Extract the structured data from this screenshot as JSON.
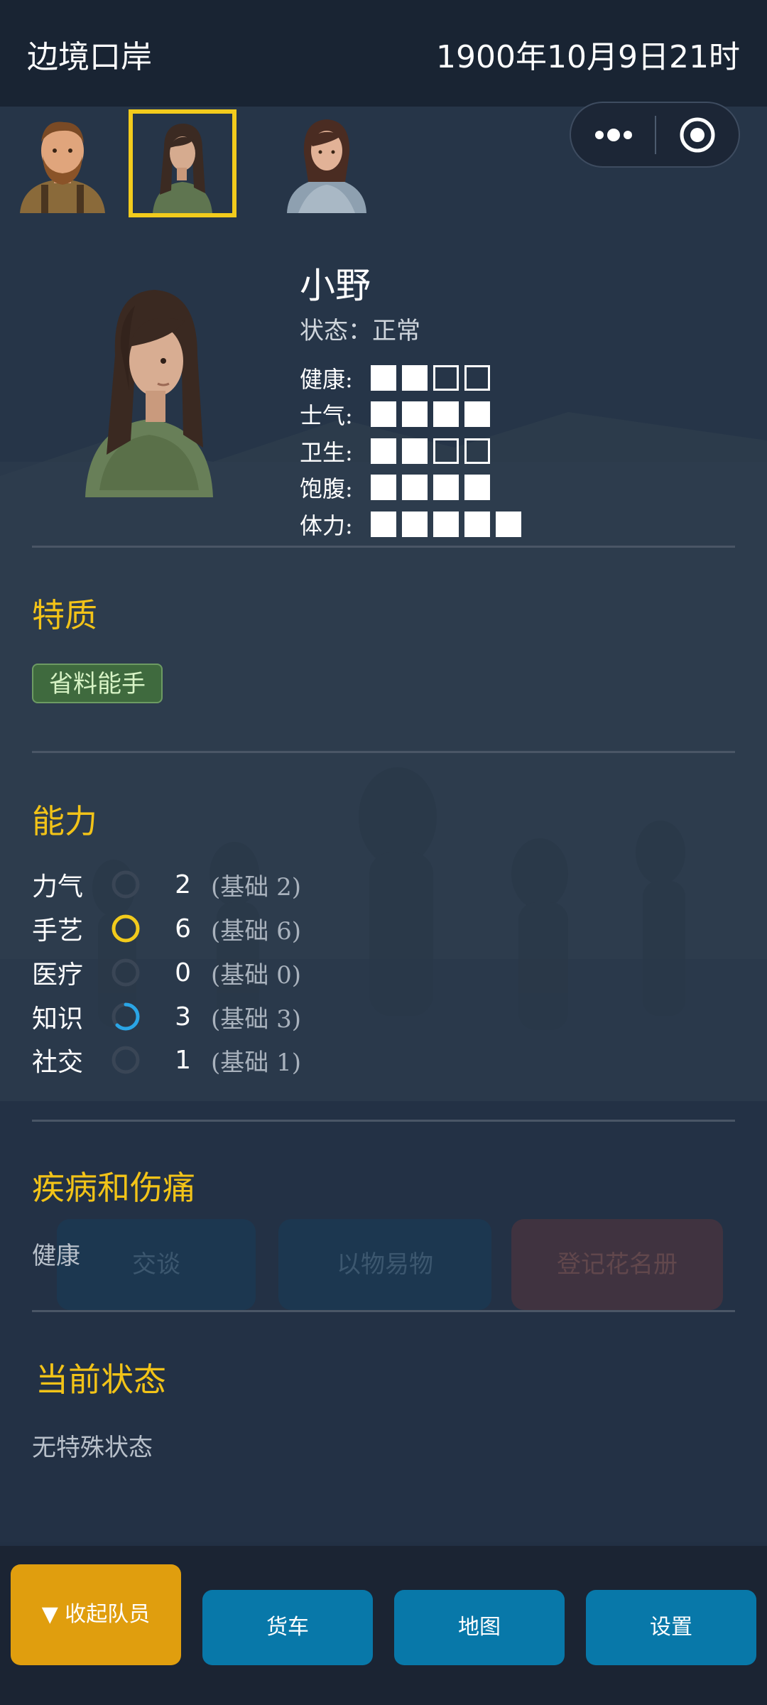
{
  "header": {
    "location": "边境口岸",
    "datetime": "1900年10月9日21时"
  },
  "capsule": {
    "more_icon": "more-dots-icon",
    "target_icon": "target-circle-icon"
  },
  "avatars": [
    {
      "name": "bearded-man",
      "selected": false
    },
    {
      "name": "girl-green-sweater",
      "selected": true
    },
    {
      "name": "woman-shawl",
      "selected": false
    }
  ],
  "character": {
    "name": "小野",
    "status": "状态：正常",
    "stats": [
      {
        "label": "健康:",
        "filled": 2,
        "total": 4
      },
      {
        "label": "士气:",
        "filled": 4,
        "total": 4
      },
      {
        "label": "卫生:",
        "filled": 2,
        "total": 4
      },
      {
        "label": "饱腹:",
        "filled": 4,
        "total": 4
      },
      {
        "label": "体力:",
        "filled": 5,
        "total": 5
      }
    ]
  },
  "traits": {
    "title": "特质",
    "items": [
      "省料能手"
    ]
  },
  "abilities": {
    "title": "能力",
    "items": [
      {
        "name": "力气",
        "value": "2",
        "base": "(基础 2)",
        "ring": "empty"
      },
      {
        "name": "手艺",
        "value": "6",
        "base": "(基础 6)",
        "ring": "full-yellow"
      },
      {
        "name": "医疗",
        "value": "0",
        "base": "(基础 0)",
        "ring": "empty"
      },
      {
        "name": "知识",
        "value": "3",
        "base": "(基础 3)",
        "ring": "partial-blue"
      },
      {
        "name": "社交",
        "value": "1",
        "base": "(基础 1)",
        "ring": "empty"
      }
    ]
  },
  "illness": {
    "title": "疾病和伤痛",
    "text": "健康"
  },
  "current_status": {
    "title": "当前状态",
    "text": "无特殊状态"
  },
  "background_buttons": [
    "交谈",
    "以物易物",
    "登记花名册"
  ],
  "bottom_bar": {
    "collapse": "▼ 收起队员",
    "truck": "货车",
    "map": "地图",
    "settings": "设置"
  },
  "colors": {
    "accent_yellow": "#f2c318",
    "button_blue": "#0878a9",
    "button_orange": "#e09e0e",
    "trait_green": "#3f6a3e"
  }
}
